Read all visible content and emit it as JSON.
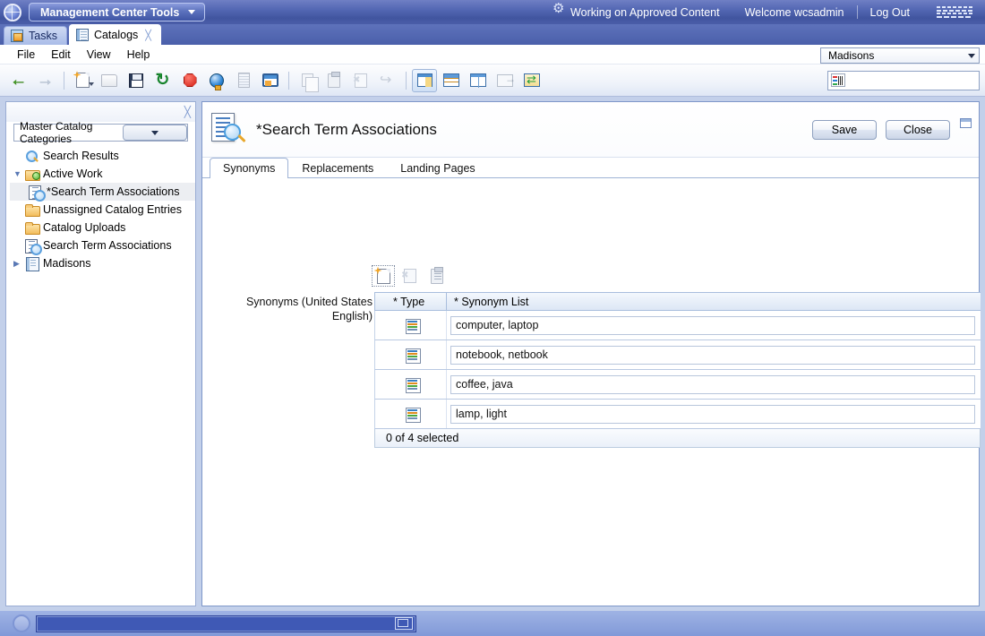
{
  "banner": {
    "globe_icon": "globe-icon",
    "app_menu_label": "Management Center Tools",
    "gear_icon": "gear-icon",
    "status_text": "Working on Approved Content",
    "welcome_text": "Welcome wcsadmin",
    "logout_label": "Log Out",
    "brand": "IBM"
  },
  "window_tabs": [
    {
      "label": "Tasks",
      "icon": "tasks-icon",
      "active": false,
      "closable": false
    },
    {
      "label": "Catalogs",
      "icon": "book-icon",
      "active": true,
      "closable": true
    }
  ],
  "menubar": {
    "items": [
      "File",
      "Edit",
      "View",
      "Help"
    ]
  },
  "store_selector": {
    "value": "Madisons",
    "icon": "chevron-down-icon"
  },
  "toolbar": {
    "buttons": [
      {
        "name": "back-button",
        "icon": "arrow-left-icon",
        "enabled": true
      },
      {
        "name": "forward-button",
        "icon": "arrow-right-icon",
        "enabled": false
      },
      {
        "name": "new-button",
        "icon": "new-document-icon",
        "enabled": true,
        "has_menu": true
      },
      {
        "name": "open-button",
        "icon": "folder-open-icon",
        "enabled": false
      },
      {
        "name": "save-button",
        "icon": "floppy-disk-icon",
        "enabled": true
      },
      {
        "name": "refresh-button",
        "icon": "refresh-icon",
        "enabled": true
      },
      {
        "name": "stop-button",
        "icon": "stop-icon",
        "enabled": true
      },
      {
        "name": "preview-button",
        "icon": "globe-preview-icon",
        "enabled": true
      },
      {
        "name": "build-button",
        "icon": "building-icon",
        "enabled": false
      },
      {
        "name": "workspace-button",
        "icon": "monitor-icon",
        "enabled": true
      },
      {
        "name": "copy-button",
        "icon": "copy-icon",
        "enabled": false
      },
      {
        "name": "paste-button",
        "icon": "clipboard-icon",
        "enabled": false
      },
      {
        "name": "delete-button",
        "icon": "delete-document-icon",
        "enabled": false
      },
      {
        "name": "find-button",
        "icon": "find-replace-icon",
        "enabled": false
      },
      {
        "name": "layout-explorer-button",
        "icon": "layout-explorer-icon",
        "enabled": true,
        "selected": true
      },
      {
        "name": "layout-horizontal-button",
        "icon": "layout-horizontal-icon",
        "enabled": true
      },
      {
        "name": "layout-vertical-button",
        "icon": "layout-vertical-icon",
        "enabled": true
      },
      {
        "name": "layout-detach-button",
        "icon": "layout-detach-icon",
        "enabled": false
      },
      {
        "name": "layout-swap-button",
        "icon": "layout-swap-icon",
        "enabled": true
      }
    ],
    "search": {
      "value": "",
      "placeholder": "",
      "left_icon": "search-scope-icon",
      "search_icon": "magnifier-icon",
      "dropdown_icon": "chevron-down-icon"
    }
  },
  "sidebar": {
    "close_icon": "close-icon",
    "selector": {
      "value": "Master Catalog Categories",
      "icon": "chevron-down-icon"
    },
    "tree": [
      {
        "label": "Search Results",
        "icon": "search-results-icon",
        "indent": 0,
        "twisty": "",
        "selected": false
      },
      {
        "label": "Active Work",
        "icon": "folder-green-icon",
        "indent": 0,
        "twisty": "expanded",
        "selected": false
      },
      {
        "label": "*Search Term Associations",
        "icon": "search-term-doc-icon",
        "indent": 1,
        "twisty": "",
        "selected": true
      },
      {
        "label": "Unassigned Catalog Entries",
        "icon": "folder-icon",
        "indent": 0,
        "twisty": "",
        "selected": false
      },
      {
        "label": "Catalog Uploads",
        "icon": "folder-icon",
        "indent": 0,
        "twisty": "",
        "selected": false
      },
      {
        "label": "Search Term Associations",
        "icon": "search-term-doc-icon",
        "indent": 0,
        "twisty": "",
        "selected": false
      },
      {
        "label": "Madisons",
        "icon": "notebook-icon",
        "indent": 0,
        "twisty": "collapsed",
        "selected": false
      }
    ]
  },
  "detail": {
    "icon": "search-term-associations-icon",
    "title": "*Search Term Associations",
    "save_label": "Save",
    "close_label": "Close",
    "maximize_icon": "maximize-icon",
    "tabs": [
      {
        "label": "Synonyms",
        "active": true
      },
      {
        "label": "Replacements",
        "active": false
      },
      {
        "label": "Landing Pages",
        "active": false
      }
    ],
    "grid_toolbar": [
      {
        "name": "new-row-button",
        "icon": "new-row-icon",
        "enabled": true,
        "focused": true
      },
      {
        "name": "delete-row-button",
        "icon": "delete-row-icon",
        "enabled": false
      },
      {
        "name": "list-button",
        "icon": "clipboard-list-icon",
        "enabled": true
      }
    ],
    "field_label": "Synonyms (United States English)",
    "grid": {
      "columns": [
        {
          "label": "* Type",
          "name": "column-type"
        },
        {
          "label": "* Synonym List",
          "name": "column-synonym-list"
        }
      ],
      "rows": [
        {
          "type_icon": "synonym-type-icon",
          "synonym_list": "computer, laptop"
        },
        {
          "type_icon": "synonym-type-icon",
          "synonym_list": "notebook, netbook"
        },
        {
          "type_icon": "synonym-type-icon",
          "synonym_list": "coffee, java"
        },
        {
          "type_icon": "synonym-type-icon",
          "synonym_list": "lamp, light"
        }
      ],
      "footer": "0 of 4 selected"
    }
  },
  "bottom_bar": {
    "circle_icon": "status-circle-icon",
    "progress_value": "",
    "restore_icon": "restore-window-icon"
  },
  "colors": {
    "banner_blue": "#4a5da8",
    "accent_blue": "#3f7fc0",
    "panel_bg": "#c3d0ea",
    "selected_row": "#eceef2"
  }
}
